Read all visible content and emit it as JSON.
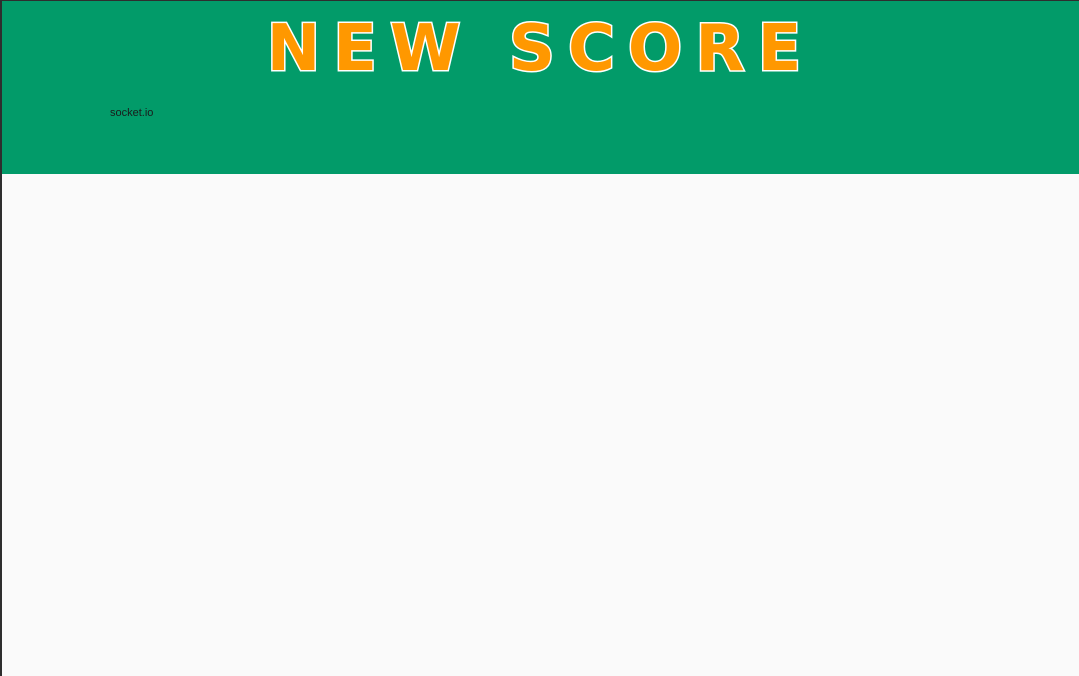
{
  "header": {
    "title": "NEW SCORE",
    "subtitle": "socket.io"
  },
  "colors": {
    "header_background": "#029b69",
    "title_fill": "#ff9800",
    "title_outline": "#ffffff",
    "page_background": "#fafafa"
  }
}
